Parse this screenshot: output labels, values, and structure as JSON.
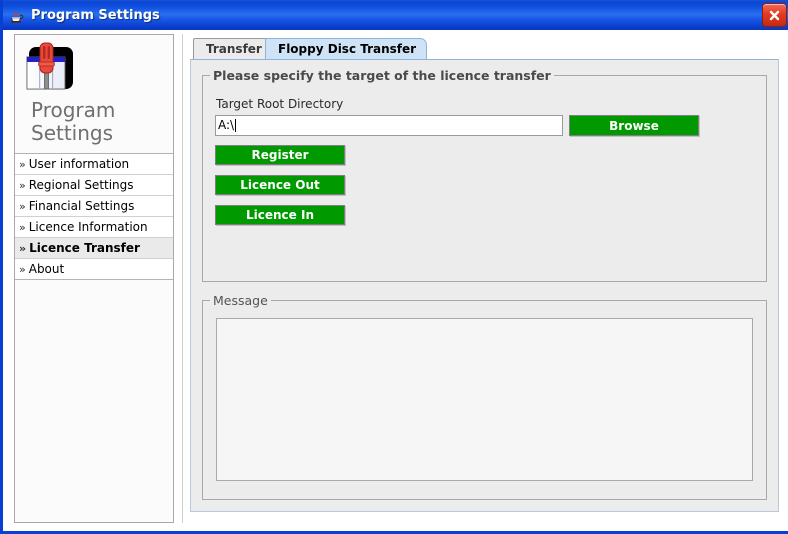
{
  "window": {
    "title": "Program Settings",
    "title_icon": "java-coffee-cup-icon",
    "close_icon": "close-icon"
  },
  "sidebar": {
    "logo_icon": "screwdriver-settings-icon",
    "logo_title": "Program\nSettings",
    "chevron": "»",
    "items": [
      {
        "label": "User information",
        "selected": false
      },
      {
        "label": "Regional Settings",
        "selected": false
      },
      {
        "label": "Financial Settings",
        "selected": false
      },
      {
        "label": "Licence Information",
        "selected": false
      },
      {
        "label": "Licence Transfer",
        "selected": true
      },
      {
        "label": "About",
        "selected": false
      }
    ]
  },
  "tabs": [
    {
      "label": "Transfer",
      "active": false
    },
    {
      "label": "Floppy Disc Transfer",
      "active": true
    }
  ],
  "target_group": {
    "legend": "Please specify the target of the licence transfer",
    "directory_label": "Target Root Directory",
    "directory_value": "A:\\",
    "directory_placeholder": "",
    "buttons": {
      "browse": "Browse",
      "register": "Register",
      "licence_out": "Licence Out",
      "licence_in": "Licence In"
    }
  },
  "message_group": {
    "legend": "Message",
    "text": ""
  },
  "colors": {
    "titlebar_blue": "#0f4fe0",
    "window_border": "#0a3fd4",
    "button_green": "#009900",
    "active_tab": "#cfe3f7",
    "inactive_tab": "#ebebeb",
    "panel_gray": "#ececec",
    "close_red": "#e33b22"
  }
}
